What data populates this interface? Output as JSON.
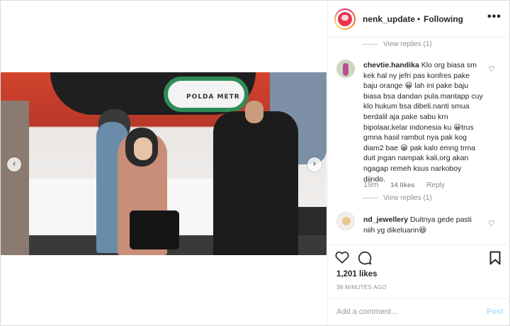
{
  "header": {
    "username": "nenk_update",
    "separator": "•",
    "follow_status": "Following",
    "more_label": "•••"
  },
  "media": {
    "banner_text": "POLDA METR",
    "prev_arrow": "‹",
    "next_arrow": "›"
  },
  "comments": {
    "view_replies_top": "View replies (1)",
    "items": [
      {
        "username": "chevtie.handika",
        "text": "Klo org biasa sm kek hal ny jefri pas konfres pake baju orange 😀 lah ini pake baju biasa bsa dandan pula.mantapp cuy klo hukum bsa dibeli.nanti smua berdalil aja pake sabu krn bipolaar,kelar indonesia ku 😀trus gmna hasil rambut nya pak kog diam2 bae 😀 pak kalo emng trma duit jngan nampak kali,org akan ngagap remeh ksus narkoboy diindo.",
        "time": "19m",
        "likes": "14 likes",
        "reply_label": "Reply",
        "view_replies": "View replies (1)"
      },
      {
        "username": "nd_jewellery",
        "text": "Duitnya gede pasti niih yg dikeluarin😆"
      }
    ]
  },
  "actions": {
    "likes_total": "1,201 likes",
    "time_ago": "38 MINUTES AGO"
  },
  "add_comment": {
    "placeholder": "Add a comment...",
    "post_label": "Post"
  },
  "colors": {
    "border": "#dbdbdb",
    "muted_text": "#8e8e8e",
    "post_disabled": "#b2dffc"
  }
}
